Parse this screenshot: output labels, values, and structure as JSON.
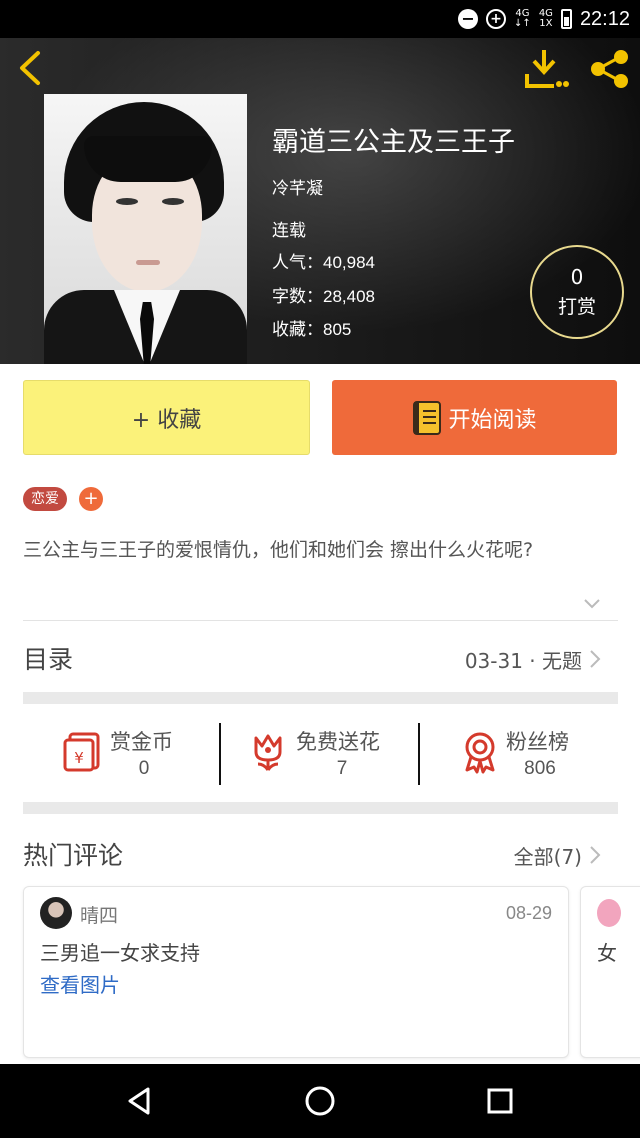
{
  "status_bar": {
    "time": "22:12",
    "net1": "4G",
    "net2": "4G",
    "net2_sub": "1X"
  },
  "header": {
    "title": "霸道三公主及三王子",
    "author": "冷芊凝",
    "status": "连载"
  },
  "stats": [
    {
      "label": "人气：",
      "value": "40,984"
    },
    {
      "label": "字数：",
      "value": "28,408"
    },
    {
      "label": "收藏：",
      "value": "805"
    }
  ],
  "reward": {
    "count": "0",
    "label": "打赏"
  },
  "actions": {
    "collect": "+ 收藏",
    "read": "开始阅读"
  },
  "tags": {
    "first": "恋爱",
    "add": "+"
  },
  "summary": "三公主与三王子的爱恨情仇，他们和她们会 擦出什么火花呢?",
  "toc": {
    "title": "目录",
    "latest": "03-31 · 无题"
  },
  "engage": [
    {
      "icon": "red-envelope-icon",
      "name": "赏金币",
      "value": "0"
    },
    {
      "icon": "flower-icon",
      "name": "免费送花",
      "value": "7"
    },
    {
      "icon": "medal-icon",
      "name": "粉丝榜",
      "value": "806"
    }
  ],
  "comments": {
    "title": "热门评论",
    "all": "全部(7)",
    "items": [
      {
        "user": "晴四",
        "date": "08-29",
        "text": "三男追一女求支持",
        "link": "查看图片"
      },
      {
        "text": "女"
      }
    ]
  },
  "colors": {
    "accent_yellow": "#fbf27a",
    "accent_orange": "#ef6a3a",
    "tag_red": "#c24a40",
    "link_blue": "#2f6bc6",
    "icon_gold": "#f2c200",
    "icon_red": "#d43a2c"
  }
}
